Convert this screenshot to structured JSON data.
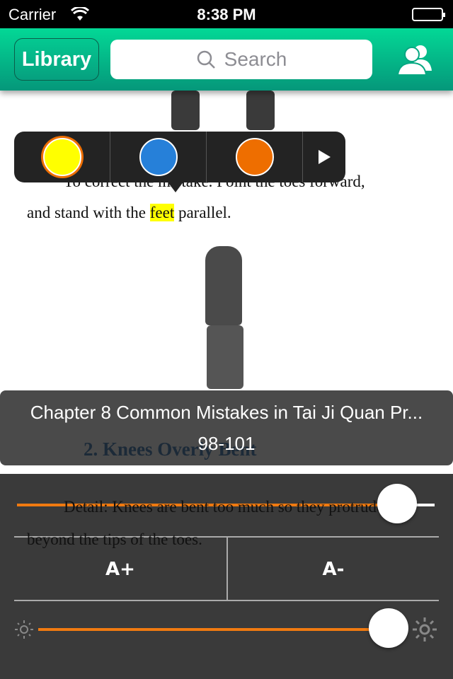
{
  "status": {
    "carrier": "Carrier",
    "time": "8:38 PM"
  },
  "nav": {
    "library": "Library",
    "search_placeholder": "Search"
  },
  "page": {
    "para1_line1": "To correct the mistake. Point the toes forward,",
    "para1_line2_pre": "and stand with the ",
    "para1_highlight": "feet",
    "para1_line2_post": " parallel.",
    "heading": "2. Knees Overly Bent",
    "para2_line1": "Detail: Knees are bent too much so they protrude",
    "para2_line2": "beyond the tips of the toes."
  },
  "highlight_menu": {
    "colors": [
      "#ffff00",
      "#2680d9",
      "#ee6e00"
    ],
    "selected": "#ffff00"
  },
  "chapter": {
    "title": "Chapter 8 Common Mistakes in Tai Ji Quan Pr...",
    "pages": "98-101"
  },
  "settings": {
    "font_size_level": 0.91,
    "increase": "A+",
    "decrease": "A-",
    "brightness": 0.94,
    "accent": "#f07a10"
  }
}
